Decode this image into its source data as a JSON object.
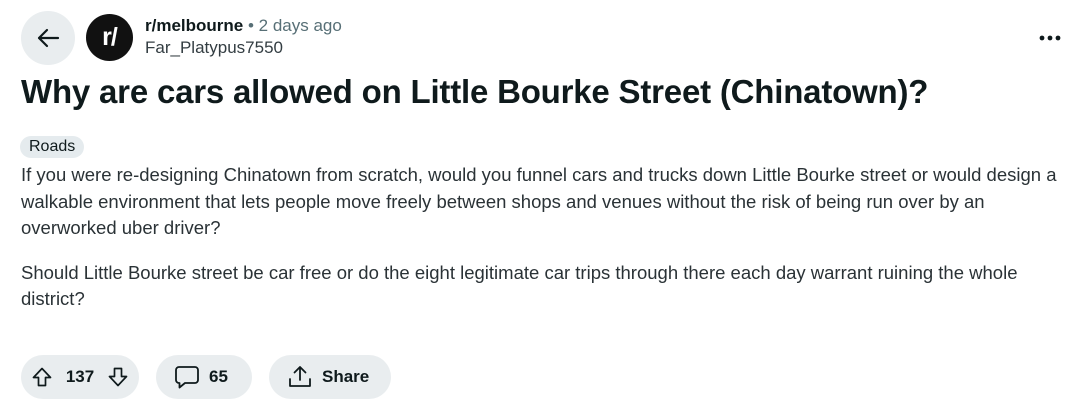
{
  "header": {
    "back_icon": "arrow-left-icon",
    "subreddit_avatar_text": "r/",
    "subreddit": "r/melbourne",
    "separator": "•",
    "timestamp": "2 days ago",
    "author": "Far_Platypus7550",
    "overflow_icon": "more-horizontal-icon"
  },
  "post": {
    "title": "Why are cars allowed on Little Bourke Street (Chinatown)?",
    "flair": "Roads",
    "paragraphs": [
      "If you were re-designing Chinatown from scratch, would you funnel cars and trucks down Little Bourke street or would design a walkable environment that lets people move freely between shops and venues without the risk of being run over by an overworked uber driver?",
      "Should Little Bourke street be car free or do the eight legitimate car trips through there each day warrant ruining the whole district?"
    ]
  },
  "actions": {
    "upvote_icon": "arrow-up-icon",
    "vote_count": "137",
    "downvote_icon": "arrow-down-icon",
    "comment_icon": "speech-bubble-icon",
    "comment_count": "65",
    "share_icon": "share-icon",
    "share_label": "Share"
  },
  "colors": {
    "background": "#ffffff",
    "pill_background": "#e9edef",
    "flair_background": "#e5ebee",
    "text_primary": "#0f1a1c",
    "text_secondary": "#576f76"
  }
}
